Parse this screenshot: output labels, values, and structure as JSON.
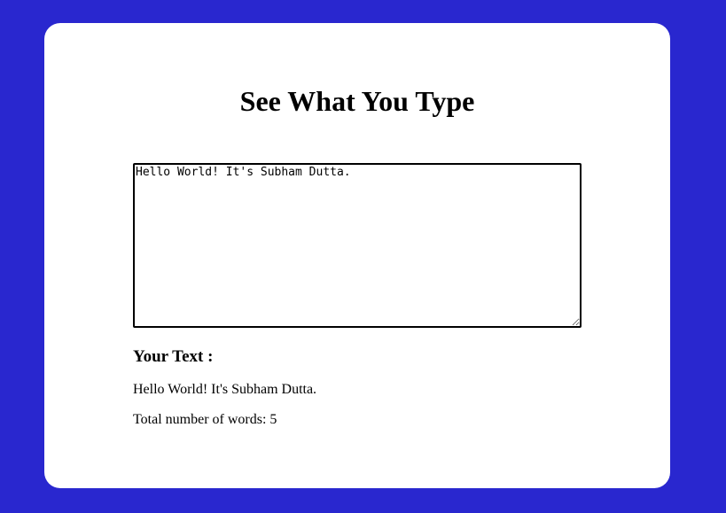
{
  "title": "See What You Type",
  "input": {
    "value": "Hello World! It's Subham Dutta."
  },
  "output": {
    "heading": "Your Text :",
    "text": "Hello World! It's Subham Dutta.",
    "word_count_label": "Total number of words: 5"
  },
  "colors": {
    "background": "#2927cf",
    "card": "#ffffff"
  }
}
